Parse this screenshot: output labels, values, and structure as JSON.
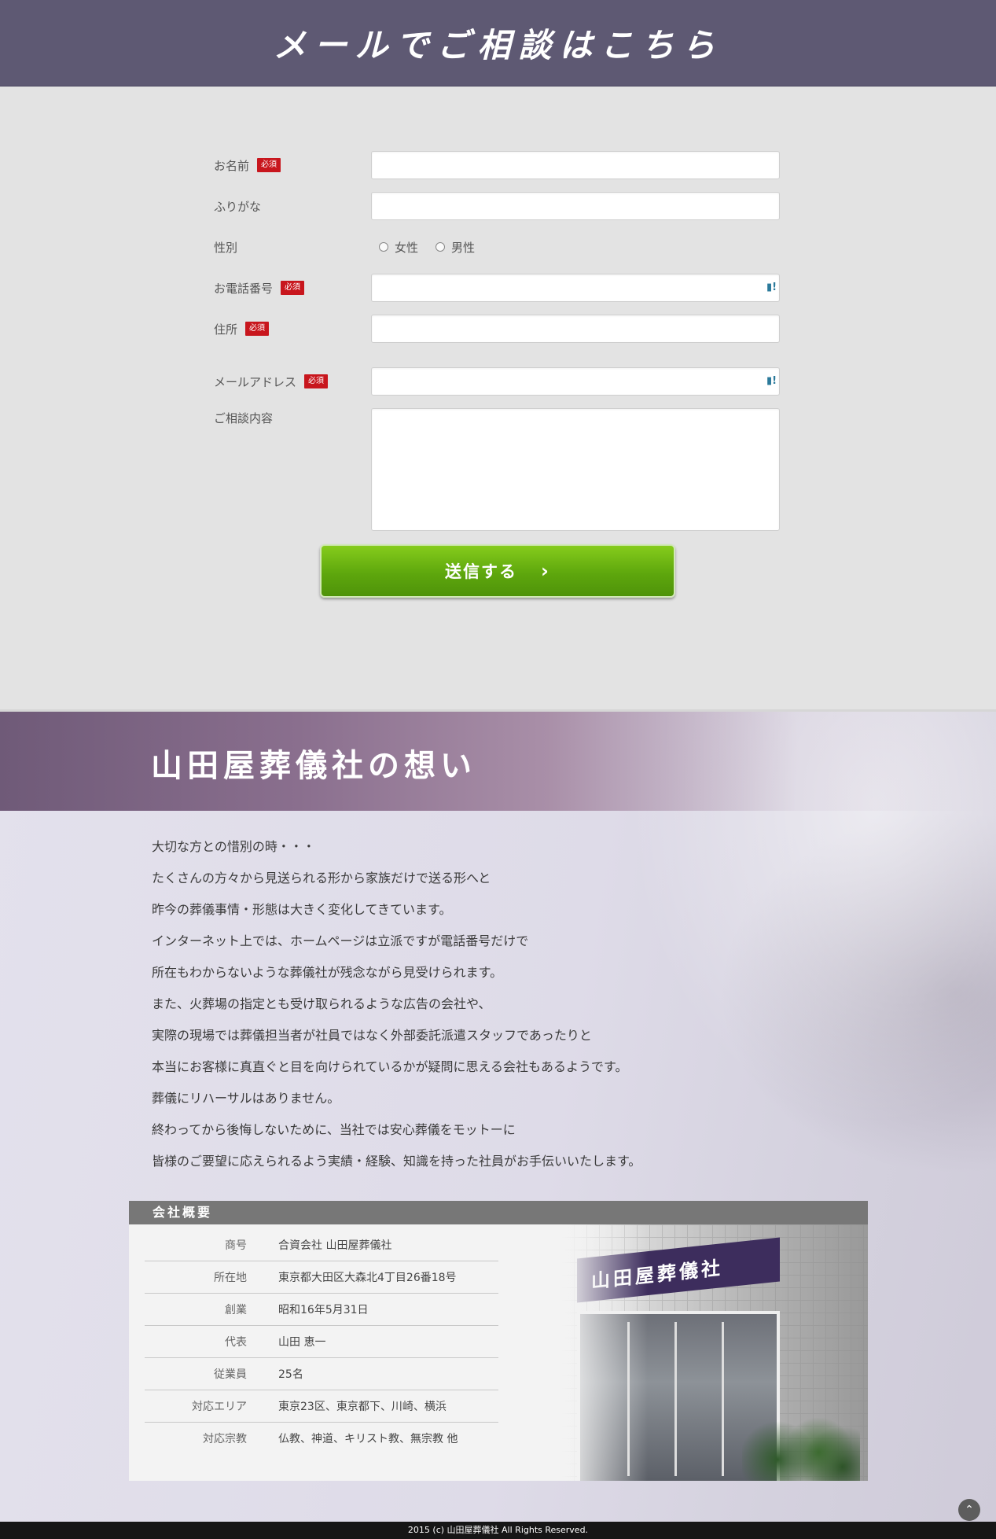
{
  "contact": {
    "title": "メールでご相談はこちら",
    "fields": [
      {
        "label": "お名前",
        "required": true,
        "value": "",
        "placeholder": ""
      },
      {
        "label": "ふりがな",
        "required": false,
        "value": "",
        "placeholder": ""
      },
      {
        "label": "性別",
        "required": false,
        "options": [
          "女性",
          "男性"
        ]
      },
      {
        "label": "お電話番号",
        "required": true,
        "value": "",
        "placeholder": ""
      },
      {
        "label": "住所",
        "required": true,
        "value": "",
        "placeholder": ""
      },
      {
        "label": "メールアドレス",
        "required": true,
        "value": "",
        "placeholder": ""
      },
      {
        "label": "ご相談内容",
        "required": false,
        "value": "",
        "placeholder": ""
      }
    ],
    "required_badge": "必須",
    "submit_label": "送信する",
    "submit_icon": "chevron-right-icon"
  },
  "philosophy": {
    "title": "山田屋葬儀社の想い",
    "lines": [
      "大切な方との惜別の時・・・",
      "たくさんの方々から見送られる形から家族だけで送る形へと",
      "昨今の葬儀事情・形態は大きく変化してきています。",
      "インターネット上では、ホームページは立派ですが電話番号だけで",
      "所在もわからないような葬儀社が残念ながら見受けられます。",
      "また、火葬場の指定とも受け取られるような広告の会社や、",
      "実際の現場では葬儀担当者が社員ではなく外部委託派遣スタッフであったりと",
      "本当にお客様に真直ぐと目を向けられているかが疑問に思える会社もあるようです。",
      "葬儀にリハーサルはありません。",
      "終わってから後悔しないために、当社では安心葬儀をモットーに",
      "皆様のご要望に応えられるよう実績・経験、知識を持った社員がお手伝いいたします。"
    ]
  },
  "company": {
    "heading": "会社概要",
    "rows": [
      {
        "label": "商号",
        "value": "合資会社 山田屋葬儀社"
      },
      {
        "label": "所在地",
        "value": "東京都大田区大森北4丁目26番18号"
      },
      {
        "label": "創業",
        "value": "昭和16年5月31日"
      },
      {
        "label": "代表",
        "value": "山田 恵一"
      },
      {
        "label": "従業員",
        "value": "25名"
      },
      {
        "label": "対応エリア",
        "value": "東京23区、東京都下、川崎、横浜"
      },
      {
        "label": "対応宗教",
        "value": "仏教、神道、キリスト教、無宗教 他"
      }
    ],
    "sign_text": "山田屋葬儀社"
  },
  "footer": {
    "copyright": "2015 (c) 山田屋葬儀社 All Rights Reserved."
  },
  "colors": {
    "header": "#5e5973",
    "required": "#c8161d",
    "submit": "#5ea70d"
  }
}
